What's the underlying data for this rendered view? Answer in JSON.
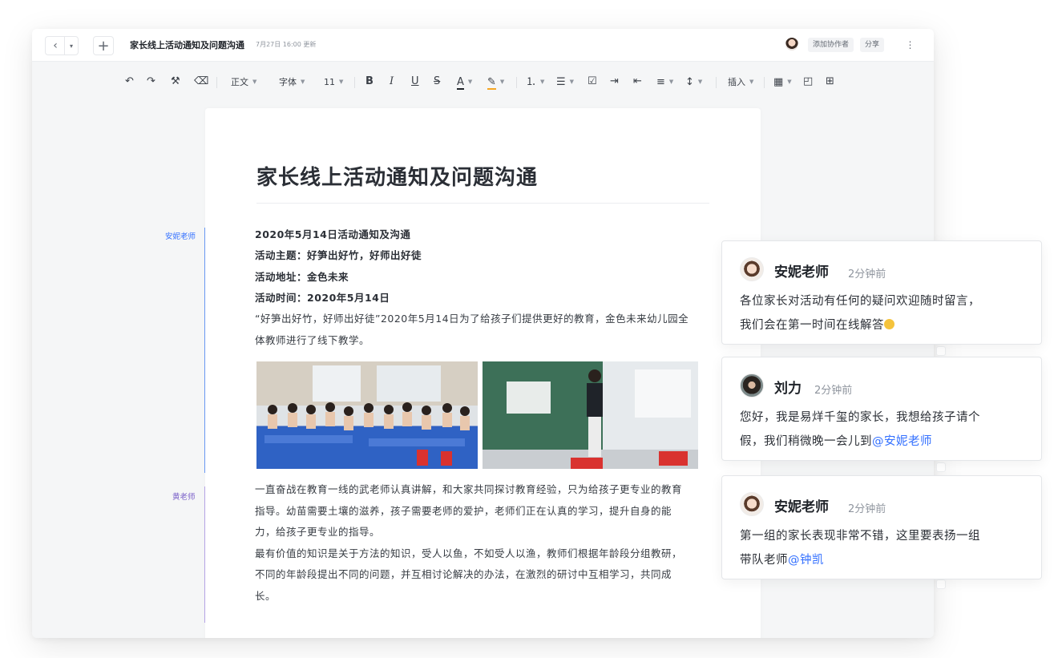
{
  "titlebar": {
    "back_icon": "‹",
    "history_icon": "▾",
    "new_icon": "+",
    "doc_title": "家长线上活动通知及问题沟通",
    "updated": "7月27日 16:00 更新",
    "collab_label": "添加协作者",
    "share_label": "分享",
    "more_icon": "⋮"
  },
  "toolbar": {
    "undo": "↶",
    "redo": "↷",
    "format_painter": "⚒",
    "clear_format": "⌫",
    "paragraph_style": "正文",
    "font": "字体",
    "font_size": "11",
    "bold": "B",
    "italic": "I",
    "underline": "U",
    "strike": "S",
    "font_color": "A",
    "highlight": "✎",
    "ordered_list": "⒈",
    "bullet_list": "☰",
    "checklist": "☑",
    "indent": "⇥",
    "outdent": "⇤",
    "align": "≡",
    "line_spacing": "↕",
    "insert": "插入",
    "table": "▦",
    "template": "◰",
    "comment": "⊞"
  },
  "doc": {
    "heading": "家长线上活动通知及问题沟通",
    "line1": "2020年5月14日活动通知及沟通",
    "line2": "活动主题：好笋出好竹，好师出好徒",
    "line3": "活动地址：金色未来",
    "line4": "活动时间：2020年5月14日",
    "line5": "“好笋出好竹，好师出好徒”2020年5月14日为了给孩子们提供更好的教育，金色未来幼儿园全",
    "line6": "体教师进行了线下教学。",
    "line7": "一直奋战在教育一线的武老师认真讲解，和大家共同探讨教育经验，只为给孩子更专业的教育",
    "line8": "指导。幼苗需要土壤的滋养，孩子需要老师的爱护，老师们正在认真的学习，提升自身的能",
    "line9": "力，给孩子更专业的指导。",
    "line10": "最有价值的知识是关于方法的知识，受人以鱼，不如受人以渔，教师们根据年龄段分组教研，",
    "line11": "不同的年龄段提出不同的问题，并互相讨论解决的办法，在激烈的研讨中互相学习，共同成",
    "line12": "长。"
  },
  "gutter": {
    "author1": "安妮老师",
    "author1_color": "#3370ff",
    "author2": "黄老师",
    "author2_color": "#7b61c9"
  },
  "comments": [
    {
      "name": "安妮老师",
      "time": "2分钟前",
      "line1": "各位家长对活动有任何的疑问欢迎随时留言，",
      "line2": "我们会在第一时间在线解答"
    },
    {
      "name": "刘力",
      "time": "2分钟前",
      "line1": "您好，我是易烊千玺的家长，我想给孩子请个",
      "line2": "假，我们稍微晚一会儿到",
      "mention": "@安妮老师"
    },
    {
      "name": "安妮老师",
      "time": "2分钟前",
      "line1": "第一组的家长表现非常不错，这里要表扬一组",
      "line2": "带队老师",
      "mention": "@钟凯"
    }
  ]
}
